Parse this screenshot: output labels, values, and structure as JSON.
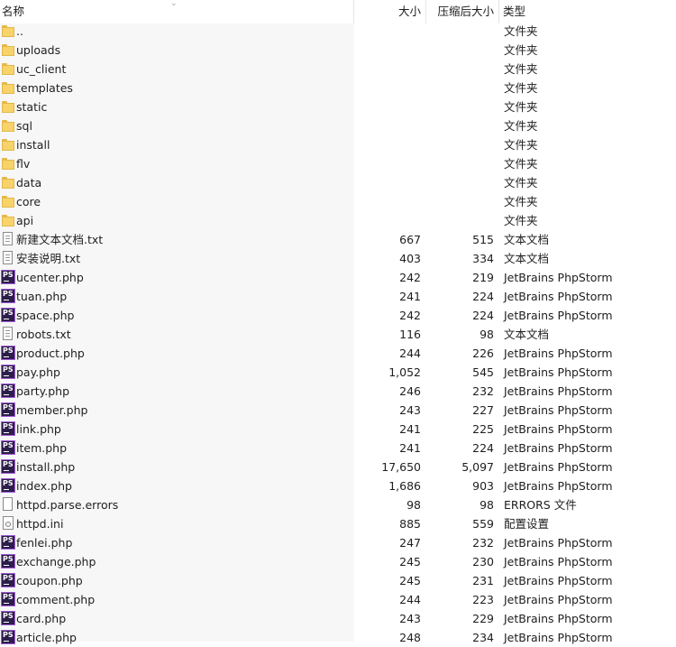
{
  "header": {
    "name": "名称",
    "size": "大小",
    "compressed": "压缩后大小",
    "type": "类型"
  },
  "files": [
    {
      "name": "..",
      "size": "",
      "compressed": "",
      "type": "文件夹",
      "icon": "folder-icon"
    },
    {
      "name": "uploads",
      "size": "",
      "compressed": "",
      "type": "文件夹",
      "icon": "folder-icon"
    },
    {
      "name": "uc_client",
      "size": "",
      "compressed": "",
      "type": "文件夹",
      "icon": "folder-icon"
    },
    {
      "name": "templates",
      "size": "",
      "compressed": "",
      "type": "文件夹",
      "icon": "folder-icon"
    },
    {
      "name": "static",
      "size": "",
      "compressed": "",
      "type": "文件夹",
      "icon": "folder-icon"
    },
    {
      "name": "sql",
      "size": "",
      "compressed": "",
      "type": "文件夹",
      "icon": "folder-icon"
    },
    {
      "name": "install",
      "size": "",
      "compressed": "",
      "type": "文件夹",
      "icon": "folder-icon"
    },
    {
      "name": "flv",
      "size": "",
      "compressed": "",
      "type": "文件夹",
      "icon": "folder-icon"
    },
    {
      "name": "data",
      "size": "",
      "compressed": "",
      "type": "文件夹",
      "icon": "folder-icon"
    },
    {
      "name": "core",
      "size": "",
      "compressed": "",
      "type": "文件夹",
      "icon": "folder-icon"
    },
    {
      "name": "api",
      "size": "",
      "compressed": "",
      "type": "文件夹",
      "icon": "folder-icon"
    },
    {
      "name": "新建文本文档.txt",
      "size": "667",
      "compressed": "515",
      "type": "文本文档",
      "icon": "text-file-icon"
    },
    {
      "name": "安装说明.txt",
      "size": "403",
      "compressed": "334",
      "type": "文本文档",
      "icon": "text-file-icon"
    },
    {
      "name": "ucenter.php",
      "size": "242",
      "compressed": "219",
      "type": "JetBrains PhpStorm",
      "icon": "phpstorm-icon"
    },
    {
      "name": "tuan.php",
      "size": "241",
      "compressed": "224",
      "type": "JetBrains PhpStorm",
      "icon": "phpstorm-icon"
    },
    {
      "name": "space.php",
      "size": "242",
      "compressed": "224",
      "type": "JetBrains PhpStorm",
      "icon": "phpstorm-icon"
    },
    {
      "name": "robots.txt",
      "size": "116",
      "compressed": "98",
      "type": "文本文档",
      "icon": "text-file-icon"
    },
    {
      "name": "product.php",
      "size": "244",
      "compressed": "226",
      "type": "JetBrains PhpStorm",
      "icon": "phpstorm-icon"
    },
    {
      "name": "pay.php",
      "size": "1,052",
      "compressed": "545",
      "type": "JetBrains PhpStorm",
      "icon": "phpstorm-icon"
    },
    {
      "name": "party.php",
      "size": "246",
      "compressed": "232",
      "type": "JetBrains PhpStorm",
      "icon": "phpstorm-icon"
    },
    {
      "name": "member.php",
      "size": "243",
      "compressed": "227",
      "type": "JetBrains PhpStorm",
      "icon": "phpstorm-icon"
    },
    {
      "name": "link.php",
      "size": "241",
      "compressed": "225",
      "type": "JetBrains PhpStorm",
      "icon": "phpstorm-icon"
    },
    {
      "name": "item.php",
      "size": "241",
      "compressed": "224",
      "type": "JetBrains PhpStorm",
      "icon": "phpstorm-icon"
    },
    {
      "name": "install.php",
      "size": "17,650",
      "compressed": "5,097",
      "type": "JetBrains PhpStorm",
      "icon": "phpstorm-icon"
    },
    {
      "name": "index.php",
      "size": "1,686",
      "compressed": "903",
      "type": "JetBrains PhpStorm",
      "icon": "phpstorm-icon"
    },
    {
      "name": "httpd.parse.errors",
      "size": "98",
      "compressed": "98",
      "type": "ERRORS 文件",
      "icon": "blank-file-icon"
    },
    {
      "name": "httpd.ini",
      "size": "885",
      "compressed": "559",
      "type": "配置设置",
      "icon": "config-file-icon"
    },
    {
      "name": "fenlei.php",
      "size": "247",
      "compressed": "232",
      "type": "JetBrains PhpStorm",
      "icon": "phpstorm-icon"
    },
    {
      "name": "exchange.php",
      "size": "245",
      "compressed": "230",
      "type": "JetBrains PhpStorm",
      "icon": "phpstorm-icon"
    },
    {
      "name": "coupon.php",
      "size": "245",
      "compressed": "231",
      "type": "JetBrains PhpStorm",
      "icon": "phpstorm-icon"
    },
    {
      "name": "comment.php",
      "size": "244",
      "compressed": "223",
      "type": "JetBrains PhpStorm",
      "icon": "phpstorm-icon"
    },
    {
      "name": "card.php",
      "size": "243",
      "compressed": "229",
      "type": "JetBrains PhpStorm",
      "icon": "phpstorm-icon"
    },
    {
      "name": "article.php",
      "size": "248",
      "compressed": "234",
      "type": "JetBrains PhpStorm",
      "icon": "phpstorm-icon"
    }
  ]
}
